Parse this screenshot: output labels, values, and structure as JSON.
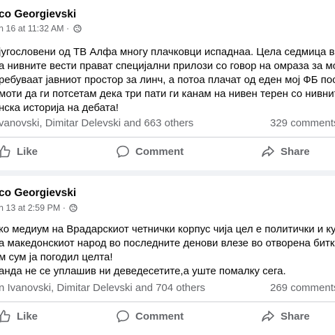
{
  "posts": [
    {
      "author": "co Georgievski",
      "time": "n 16 at 11:32 AM ·",
      "lines": [
        "југословени од ТВ Алфа многу плачковци испаднаа. Цела седмица во уд",
        "а нивните вести прават специјални прилози со говор на омраза за моите",
        "ребуваат јавниот простор за линч, а потоа плачат од еден мој ФБ пост. А",
        "моти да ги потсетам дека три пати ги канам на нивен терен со нивните е",
        "нска историја на дебата!"
      ],
      "reactions": "vanovski, Dimitar Delevski and 663 others",
      "comments": "329 comments",
      "actions": {
        "like": "Like",
        "comment": "Comment",
        "share": "Share"
      }
    },
    {
      "author": "co Georgievski",
      "time": "n 13 at 2:59 PM ·",
      "lines": [
        "ко медиум на Врадарскиот четнички корпус чија цел е политички и кул",
        "а македонскиот народ во последните денови влезе во отворена битка с",
        "м сум ја погодил целта!",
        "анда не се уплашив ни деведесетите,а уште помалку сега."
      ],
      "reactions": "n Ivanovski, Dimitar Delevski and 704 others",
      "comments": "269 comments",
      "actions": {
        "like": "Like",
        "comment": "Comment",
        "share": "Share"
      }
    }
  ],
  "icons": {
    "privacy": "globe-icon",
    "like": "thumbs-up-icon",
    "comment": "speech-bubble-icon",
    "share": "share-arrow-icon"
  },
  "colors": {
    "background": "#f0f2f5",
    "card": "#ffffff",
    "primary_text": "#050505",
    "secondary_text": "#65676b",
    "divider": "#ced0d4"
  }
}
